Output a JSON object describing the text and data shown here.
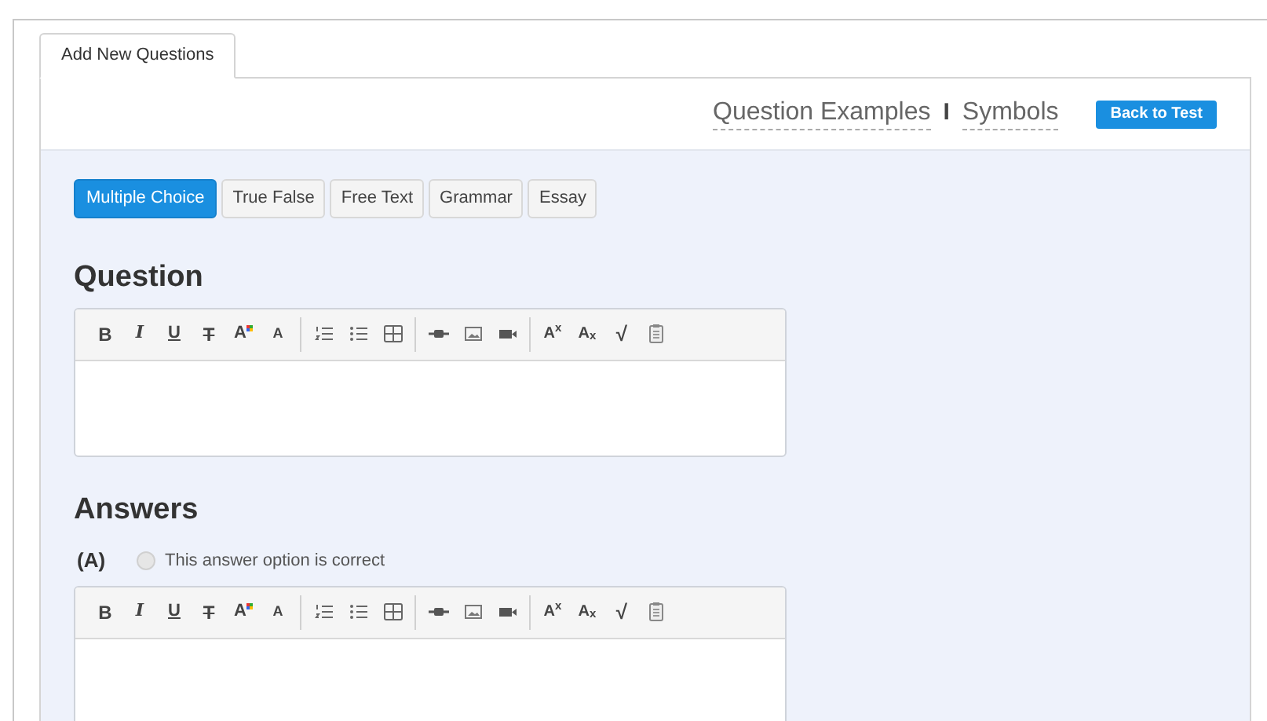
{
  "tabs": [
    {
      "label": "Add New Questions",
      "selected": true
    }
  ],
  "header": {
    "links": [
      {
        "label": "Question Examples"
      },
      {
        "label": "Symbols"
      }
    ],
    "separator": "I",
    "button": "Back to Test"
  },
  "question_types": [
    {
      "label": "Multiple Choice",
      "selected": true
    },
    {
      "label": "True False",
      "selected": false
    },
    {
      "label": "Free Text",
      "selected": false
    },
    {
      "label": "Grammar",
      "selected": false
    },
    {
      "label": "Essay",
      "selected": false
    }
  ],
  "question": {
    "heading": "Question",
    "editor": {
      "toolbar": [
        [
          {
            "kind": "bold",
            "text": "B"
          },
          {
            "kind": "italic",
            "text": "I"
          },
          {
            "kind": "underline",
            "text": "U"
          },
          {
            "kind": "strike",
            "text": "T"
          },
          {
            "kind": "color",
            "text": "A"
          },
          {
            "kind": "size",
            "text": "A"
          }
        ],
        [
          {
            "kind": "ordered-list"
          },
          {
            "kind": "bullet-list"
          },
          {
            "kind": "table"
          }
        ],
        [
          {
            "kind": "link"
          },
          {
            "kind": "image"
          },
          {
            "kind": "video"
          }
        ],
        [
          {
            "kind": "superscript",
            "text": "A$^{x}$"
          },
          {
            "kind": "subscript",
            "text": "A$_{x}$"
          },
          {
            "kind": "formula",
            "text": "√"
          },
          {
            "kind": "paste"
          }
        ]
      ]
    }
  },
  "answers": {
    "heading": "Answers",
    "items": [
      {
        "letter": "(A)",
        "correct_label": "This answer option is correct",
        "checked": false,
        "editor": {
          "toolbar": [
            [
              {
                "kind": "bold",
                "text": "B"
              },
              {
                "kind": "italic",
                "text": "I"
              },
              {
                "kind": "underline",
                "text": "U"
              },
              {
                "kind": "strike",
                "text": "T"
              },
              {
                "kind": "color",
                "text": "A"
              },
              {
                "kind": "size",
                "text": "A"
              }
            ],
            [
              {
                "kind": "ordered-list"
              },
              {
                "kind": "bullet-list"
              },
              {
                "kind": "table"
              }
            ],
            [
              {
                "kind": "link"
              },
              {
                "kind": "image"
              },
              {
                "kind": "video"
              }
            ],
            [
              {
                "kind": "superscript",
                "text": "A$^{x}$"
              },
              {
                "kind": "subscript",
                "text": "A$_{x}$"
              },
              {
                "kind": "formula",
                "text": "√"
              },
              {
                "kind": "paste"
              }
            ]
          ]
        }
      }
    ]
  }
}
